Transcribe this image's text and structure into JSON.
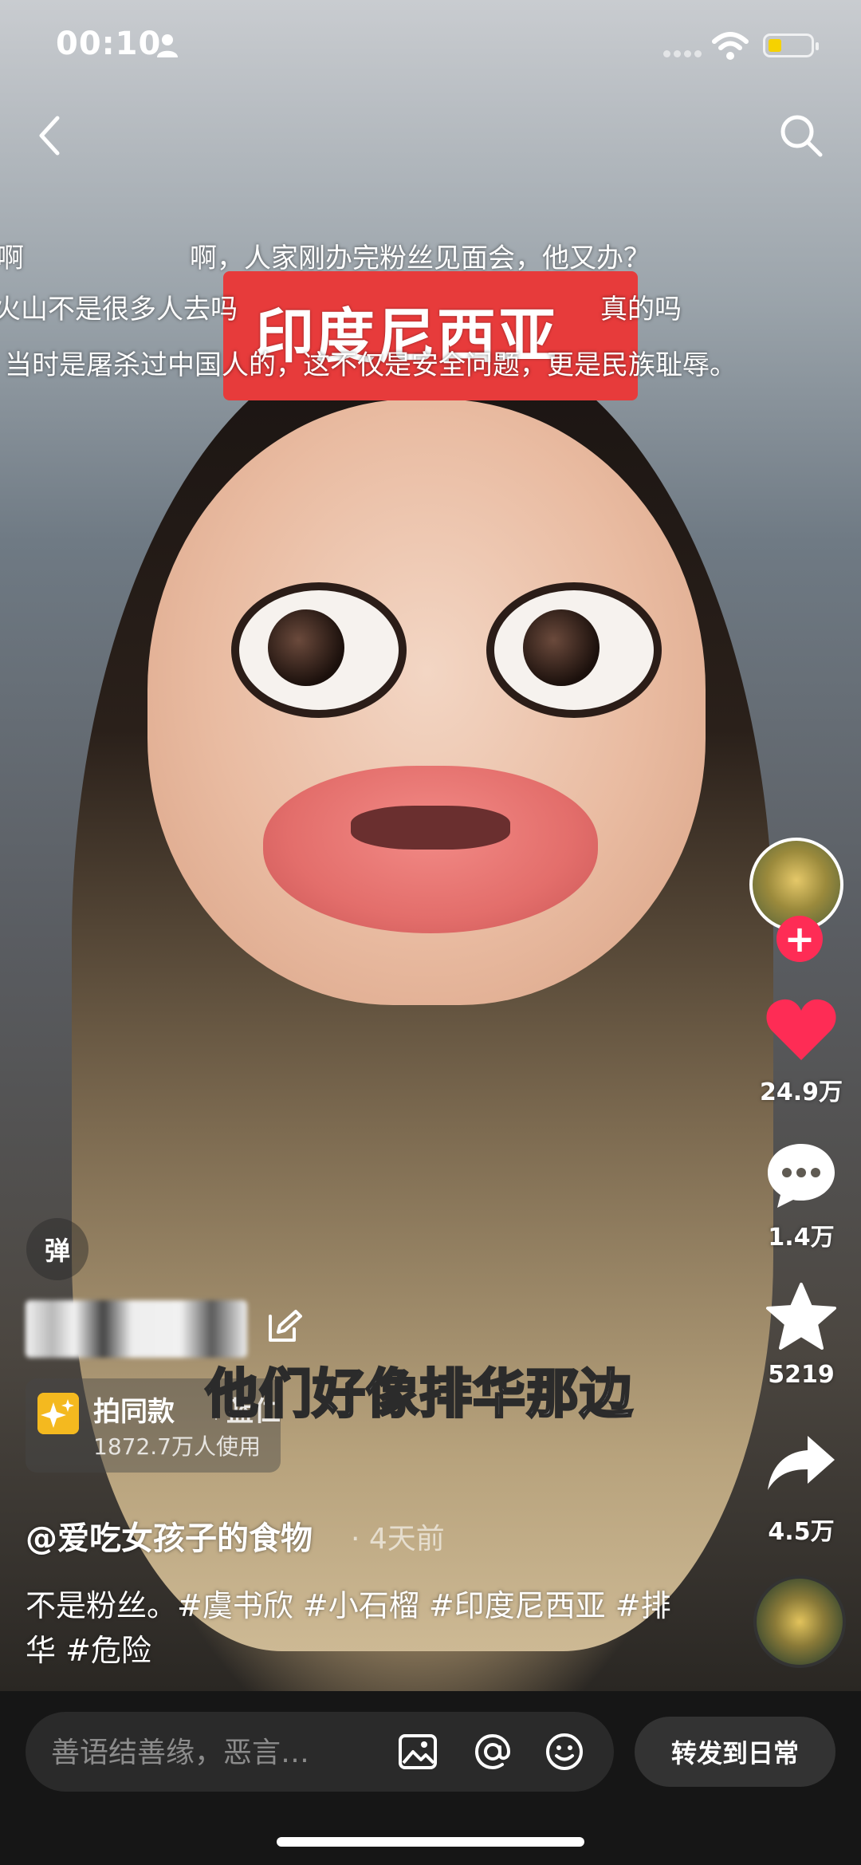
{
  "status_bar": {
    "time": "00:10",
    "battery_color": "#f6d200"
  },
  "overlay": {
    "danmaku": [
      "啊",
      "啊，人家刚办完粉丝见面会，他又办？",
      "火山不是很多人去吗",
      "真的吗",
      "当时是屠杀过中国人的，这不仅是安全问题，更是民族耻辱。"
    ],
    "title_tag": "印度尼西亚",
    "subtitle": "他们好像排华那边"
  },
  "right_rail": {
    "like_count": "24.9万",
    "comment_count": "1.4万",
    "favorite_count": "5219",
    "share_count": "4.5万",
    "like_color": "#fe2c55"
  },
  "danmu_toggle_label": "弹",
  "template": {
    "title": "拍同款",
    "tag": "蓝仁",
    "users": "1872.7万人使用"
  },
  "post": {
    "author": "@爱吃女孩子的食物",
    "time_ago": "· 4天前",
    "description": "不是粉丝。#虞书欣 #小石榴 #印度尼西亚 #排华 #危险"
  },
  "bottom_bar": {
    "comment_placeholder": "善语结善缘，恶言…",
    "forward_label": "转发到日常"
  }
}
